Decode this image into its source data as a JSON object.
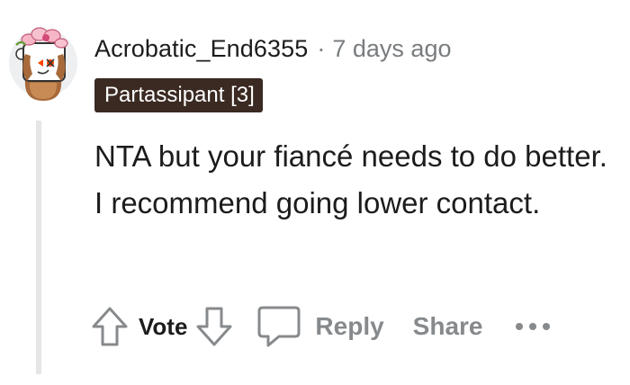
{
  "comment": {
    "author": "Acrobatic_End6355",
    "separator": "·",
    "timestamp": "7 days ago",
    "flair": "Partassipant [3]",
    "text": "NTA but your fiancé needs to do better. I recommend going lower contact."
  },
  "actions": {
    "vote_label": "Vote",
    "reply_label": "Reply",
    "share_label": "Share",
    "more_label": "•••"
  },
  "icons": {
    "upvote": "upvote-arrow-icon",
    "downvote": "downvote-arrow-icon",
    "reply": "speech-bubble-icon",
    "more": "ellipsis-icon"
  },
  "colors": {
    "text": "#1c1c1c",
    "muted": "#787c7e",
    "action_gray": "#878a8c",
    "flair_bg": "#3a2a22",
    "flair_text": "#ffffff",
    "thread_line": "#e6e6e6"
  }
}
